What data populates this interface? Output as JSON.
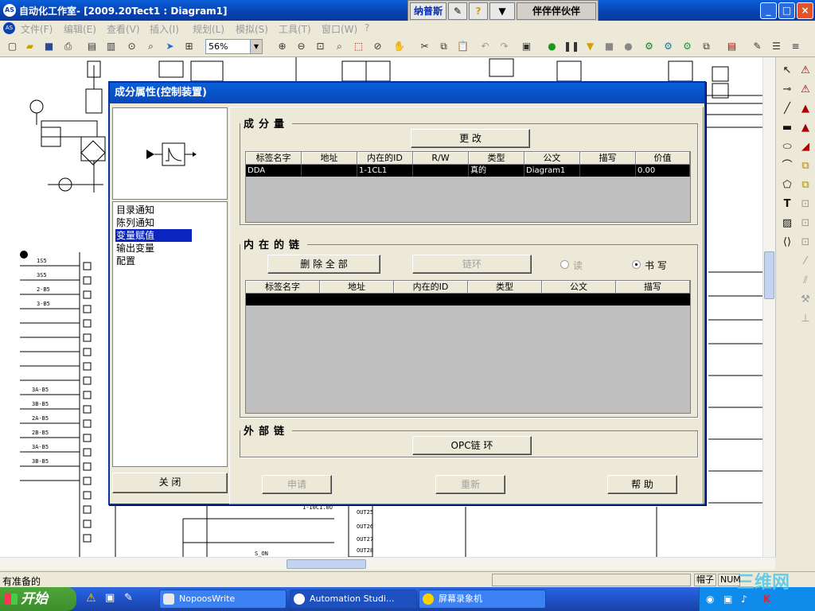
{
  "window": {
    "title": "自动化工作室- [2009.20Tect1 : Diagram1]",
    "app_icon": "AS"
  },
  "ime": {
    "label": "纳普斯",
    "phrase": "伴伴伴伙伴"
  },
  "menu": [
    "文件(F)",
    "编辑(E)",
    "查看(V)",
    "插入(I)",
    "规划(L)",
    "模拟(S)",
    "工具(T)",
    "窗口(W)",
    "?"
  ],
  "toolbar": {
    "zoom": "56%"
  },
  "dialog": {
    "title": "成分属性(控制装置)",
    "nav": [
      "目录通知",
      "陈列通知",
      "变量赋值",
      "输出变量",
      "配置"
    ],
    "nav_selected": 2,
    "close": "关 闭",
    "variables": {
      "title": "成分量",
      "change": "更 改",
      "columns": [
        "标签名字",
        "地址",
        "内在的ID",
        "R/W",
        "类型",
        "公文",
        "描写",
        "价值"
      ],
      "rows": [
        [
          "DDA",
          "",
          "1-1CL1",
          "",
          "真的",
          "Diagram1",
          "",
          "0.00"
        ]
      ]
    },
    "internal": {
      "title": "内在的链",
      "delete_all": "删 除 全 部",
      "link": "链环",
      "read": "读",
      "write": "书 写",
      "columns": [
        "标签名字",
        "地址",
        "内在的ID",
        "类型",
        "公文",
        "描写"
      ]
    },
    "external": {
      "title": "外部链",
      "opc": "OPC链 环"
    },
    "apply": "申请",
    "reset": "重新",
    "help": "帮 助"
  },
  "status": {
    "text": "有准备的",
    "cap": "帽子",
    "num": "NUM"
  },
  "taskbar": {
    "start": "开始",
    "tasks": [
      "NopoosWrite",
      "Automation Studi...",
      "屏幕录象机"
    ]
  },
  "watermark": "三维网"
}
